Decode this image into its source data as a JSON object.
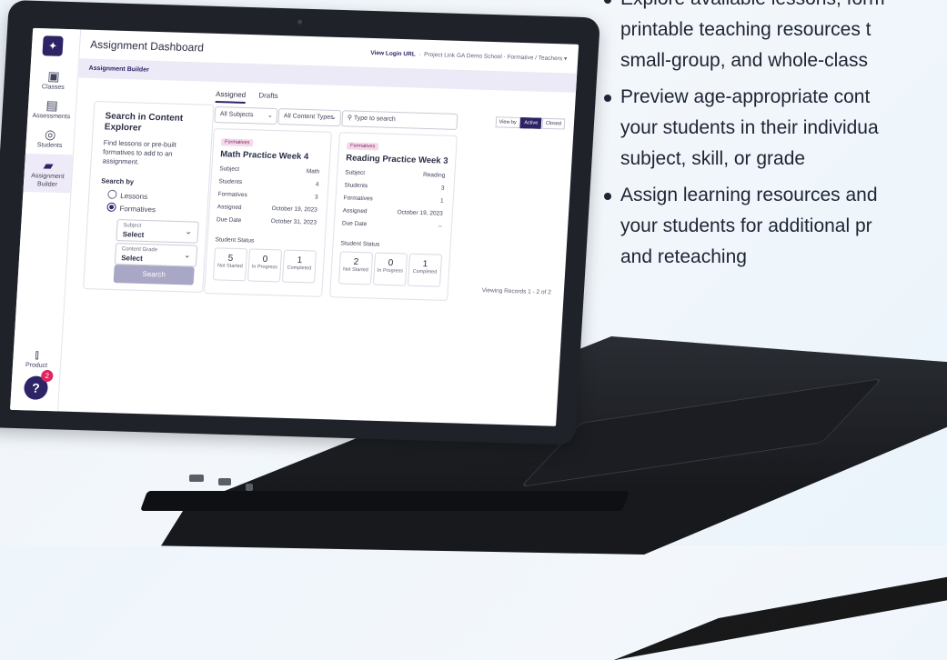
{
  "sidebar": {
    "items": [
      {
        "label": "Classes",
        "icon": "classes-icon"
      },
      {
        "label": "Assessments",
        "icon": "assessments-icon"
      },
      {
        "label": "Students",
        "icon": "students-icon"
      },
      {
        "label": "Assignment Builder",
        "icon": "assignment-builder-icon"
      },
      {
        "label": "Product",
        "icon": "product-icon"
      }
    ],
    "help_badge": "2"
  },
  "header": {
    "title": "Assignment Dashboard",
    "link": "View Login URL",
    "breadcrumb": "Project Link GA Demo School · Formative / Teachers"
  },
  "subheader": {
    "title": "Assignment Builder"
  },
  "tabs": [
    "Assigned",
    "Drafts"
  ],
  "search_panel": {
    "title": "Search in Content Explorer",
    "description": "Find lessons or pre-built formatives to add to an assignment.",
    "search_by": "Search by",
    "options": [
      "Lessons",
      "Formatives"
    ],
    "selected_option": "Formatives",
    "subject_caption": "Subject",
    "subject_value": "Select",
    "grade_caption": "Content Grade",
    "grade_value": "Select",
    "search_button": "Search"
  },
  "filters": {
    "subjects": "All Subjects",
    "content_types": "All Content Types",
    "search_placeholder": "Type to search",
    "view_label": "View by",
    "active": "Active",
    "closed": "Closed"
  },
  "cards": [
    {
      "badge": "Formatives",
      "title": "Math Practice Week 4",
      "subject_label": "Subject",
      "subject": "Math",
      "students_label": "Students",
      "students": "4",
      "formatives_label": "Formatives",
      "formatives": "3",
      "assigned_label": "Assigned",
      "assigned": "October 19, 2023",
      "due_label": "Due Date",
      "due": "October 31, 2023",
      "status_label": "Student Status",
      "not_started": "5",
      "not_started_label": "Not Started",
      "in_progress": "0",
      "in_progress_label": "In Progress",
      "completed": "1",
      "completed_label": "Completed"
    },
    {
      "badge": "Formatives",
      "title": "Reading Practice Week 3",
      "subject_label": "Subject",
      "subject": "Reading",
      "students_label": "Students",
      "students": "3",
      "formatives_label": "Formatives",
      "formatives": "1",
      "assigned_label": "Assigned",
      "assigned": "October 19, 2023",
      "due_label": "Due Date",
      "due": "--",
      "status_label": "Student Status",
      "not_started": "2",
      "not_started_label": "Not Started",
      "in_progress": "0",
      "in_progress_label": "In Progress",
      "completed": "1",
      "completed_label": "Completed"
    }
  ],
  "viewing": "Viewing Records 1 - 2 of 2",
  "bullets": [
    [
      "Explore available lessons, form",
      "printable teaching resources t",
      "small-group, and whole-class"
    ],
    [
      "Preview age-appropriate cont",
      "your students in their individua",
      "subject, skill, or grade"
    ],
    [
      "Assign learning resources and",
      "your students for additional pr",
      "and reteaching"
    ]
  ],
  "colors": {
    "brand": "#2d2466",
    "accent_badge": "#e0245e",
    "background": "#eef5fb"
  }
}
